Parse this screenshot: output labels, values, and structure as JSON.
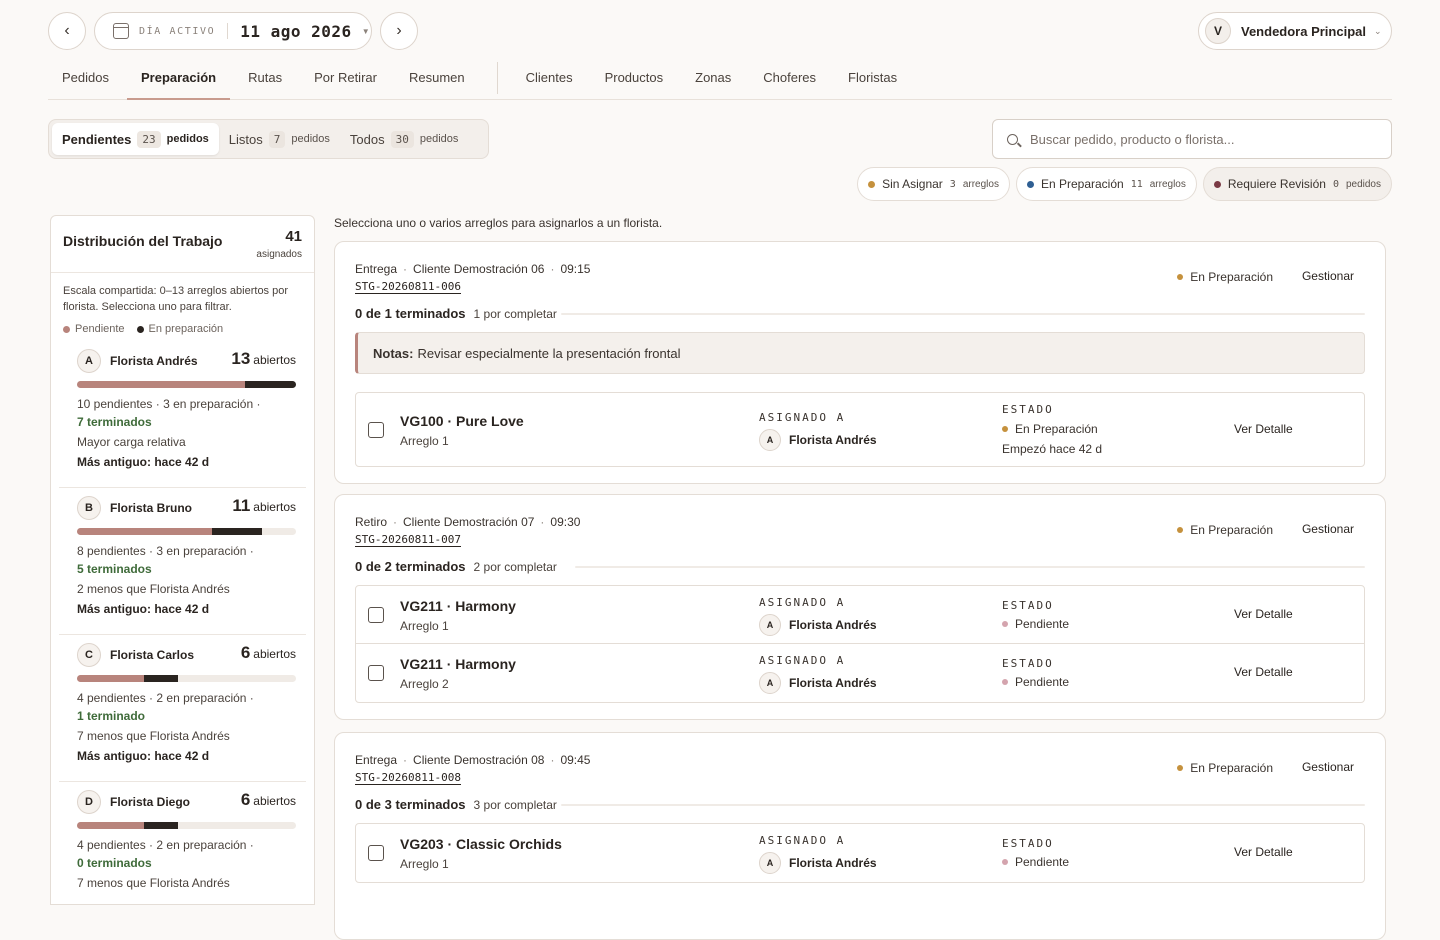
{
  "topbar": {
    "prev_icon": "chevron-left-icon",
    "next_icon": "chevron-right-icon",
    "calendar_icon": "calendar-icon",
    "date_label": "DÍA ACTIVO",
    "date_value": "11 ago 2026",
    "user_initial": "V",
    "user_name": "Vendedora Principal"
  },
  "nav": {
    "tabs_left": [
      "Pedidos",
      "Preparación",
      "Rutas",
      "Por Retirar",
      "Resumen"
    ],
    "tabs_right": [
      "Clientes",
      "Productos",
      "Zonas",
      "Choferes",
      "Floristas"
    ],
    "active": "Preparación"
  },
  "filters": {
    "options": [
      {
        "label": "Pendientes",
        "count": "23",
        "unit": "pedidos"
      },
      {
        "label": "Listos",
        "count": "7",
        "unit": "pedidos"
      },
      {
        "label": "Todos",
        "count": "30",
        "unit": "pedidos"
      }
    ],
    "search_placeholder": "Buscar pedido, producto o florista..."
  },
  "chips": [
    {
      "label": "Sin Asignar",
      "count": "3",
      "unit": "arreglos",
      "color": "#c5913d"
    },
    {
      "label": "En Preparación",
      "count": "11",
      "unit": "arreglos",
      "color": "#2f5f93"
    },
    {
      "label": "Requiere Revisión",
      "count": "0",
      "unit": "pedidos",
      "color": "#7a3a44"
    }
  ],
  "sidebar": {
    "title": "Distribución del Trabajo",
    "total": "41",
    "total_label": "asignados",
    "description": "Escala compartida: 0–13 arreglos abiertos por florista. Selecciona uno para filtrar.",
    "legend_pending": "Pendiente",
    "legend_prep": "En preparación",
    "colors": {
      "pending": "#b8847c",
      "prep": "#2a2420"
    },
    "scale_max": 13,
    "florists": [
      {
        "initial": "A",
        "name": "Florista Andrés",
        "open": "13",
        "open_label": "abiertos",
        "pending": 10,
        "in_prep": 3,
        "l1": "10 pendientes · 3 en preparación ·",
        "l2": "7 terminados",
        "l3": "Mayor carga relativa",
        "l4": "Más antiguo: hace 42 d"
      },
      {
        "initial": "B",
        "name": "Florista Bruno",
        "open": "11",
        "open_label": "abiertos",
        "pending": 8,
        "in_prep": 3,
        "l1": "8 pendientes · 3 en preparación ·",
        "l2": "5 terminados",
        "l3": "2 menos que Florista Andrés",
        "l4": "Más antiguo: hace 42 d"
      },
      {
        "initial": "C",
        "name": "Florista Carlos",
        "open": "6",
        "open_label": "abiertos",
        "pending": 4,
        "in_prep": 2,
        "l1": "4 pendientes · 2 en preparación ·",
        "l2": "1 terminado",
        "l3": "7 menos que Florista Andrés",
        "l4": "Más antiguo: hace 42 d"
      },
      {
        "initial": "D",
        "name": "Florista Diego",
        "open": "6",
        "open_label": "abiertos",
        "pending": 4,
        "in_prep": 2,
        "l1": "4 pendientes · 2 en preparación ·",
        "l2": "0 terminados",
        "l3": "7 menos que Florista Andrés",
        "l4": ""
      }
    ]
  },
  "main": {
    "hint": "Selecciona uno o varios arreglos para asignarlos a un florista.",
    "assigned_head": "ASIGNADO A",
    "state_head": "ESTADO",
    "detail_label": "Ver Detalle",
    "manage_label": "Gestionar",
    "orders": [
      {
        "type": "Entrega",
        "client": "Cliente Demostración 06",
        "time": "09:15",
        "code": "STG-20260811-006",
        "status": "En Preparación",
        "progress_done": "0 de 1 terminados",
        "progress_rest": "1 por completar",
        "notes_label": "Notas:",
        "notes": "Revisar especialmente la presentación frontal",
        "items": [
          {
            "name": "VG100 · Pure Love",
            "sub": "Arreglo 1",
            "assignee_initial": "A",
            "assignee": "Florista Andrés",
            "state": "En Preparación",
            "state_color": "#c5913d",
            "state_sub": "Empezó hace 42 d"
          }
        ]
      },
      {
        "type": "Retiro",
        "client": "Cliente Demostración 07",
        "time": "09:30",
        "code": "STG-20260811-007",
        "status": "En Preparación",
        "progress_done": "0 de 2 terminados",
        "progress_rest": "2 por completar",
        "items": [
          {
            "name": "VG211 · Harmony",
            "sub": "Arreglo 1",
            "assignee_initial": "A",
            "assignee": "Florista Andrés",
            "state": "Pendiente",
            "state_color": "#d4a4ae"
          },
          {
            "name": "VG211 · Harmony",
            "sub": "Arreglo 2",
            "assignee_initial": "A",
            "assignee": "Florista Andrés",
            "state": "Pendiente",
            "state_color": "#d4a4ae"
          }
        ]
      },
      {
        "type": "Entrega",
        "client": "Cliente Demostración 08",
        "time": "09:45",
        "code": "STG-20260811-008",
        "status": "En Preparación",
        "progress_done": "0 de 3 terminados",
        "progress_rest": "3 por completar",
        "items": [
          {
            "name": "VG203 · Classic Orchids",
            "sub": "Arreglo 1",
            "assignee_initial": "A",
            "assignee": "Florista Andrés",
            "state": "Pendiente",
            "state_color": "#d4a4ae"
          }
        ]
      }
    ]
  }
}
